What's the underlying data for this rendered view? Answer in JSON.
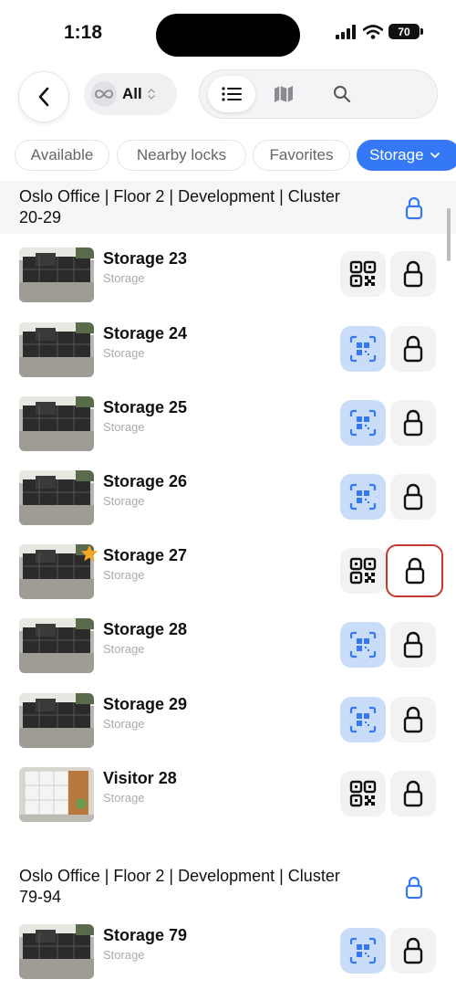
{
  "status": {
    "time": "1:18",
    "battery": "70"
  },
  "toolbar": {
    "back_icon": "chevron-left-icon",
    "scope_icon": "infinity-icon",
    "scope_label": "All",
    "list_icon": "list-icon",
    "map_icon": "map-icon",
    "search_icon": "search-icon"
  },
  "filters": [
    {
      "label": "Available",
      "selected": false
    },
    {
      "label": "Nearby locks",
      "selected": false
    },
    {
      "label": "Favorites",
      "selected": false
    },
    {
      "label": "Storage",
      "selected": true
    }
  ],
  "sections": [
    {
      "title": "Oslo Office | Floor 2 | Development | Cluster 20-29",
      "items": [
        {
          "name": "Storage 23",
          "sub": "Storage",
          "qr_style": "plain",
          "favorite": false,
          "highlighted": false
        },
        {
          "name": "Storage 24",
          "sub": "Storage",
          "qr_style": "blue",
          "favorite": false,
          "highlighted": false
        },
        {
          "name": "Storage 25",
          "sub": "Storage",
          "qr_style": "blue",
          "favorite": false,
          "highlighted": false
        },
        {
          "name": "Storage 26",
          "sub": "Storage",
          "qr_style": "blue",
          "favorite": false,
          "highlighted": false
        },
        {
          "name": "Storage 27",
          "sub": "Storage",
          "qr_style": "plain",
          "favorite": true,
          "highlighted": true
        },
        {
          "name": "Storage 28",
          "sub": "Storage",
          "qr_style": "blue",
          "favorite": false,
          "highlighted": false
        },
        {
          "name": "Storage 29",
          "sub": "Storage",
          "qr_style": "blue",
          "favorite": false,
          "highlighted": false
        },
        {
          "name": "Visitor 28",
          "sub": "Storage",
          "qr_style": "plain",
          "favorite": false,
          "highlighted": false
        }
      ]
    },
    {
      "title": "Oslo Office | Floor 2 | Development | Cluster 79-94",
      "items": [
        {
          "name": "Storage 79",
          "sub": "Storage",
          "qr_style": "blue",
          "favorite": false,
          "highlighted": false
        }
      ]
    }
  ],
  "colors": {
    "accent": "#3478f6",
    "highlight": "#c8372d",
    "qr_blue_bg": "#c9dcf8"
  }
}
